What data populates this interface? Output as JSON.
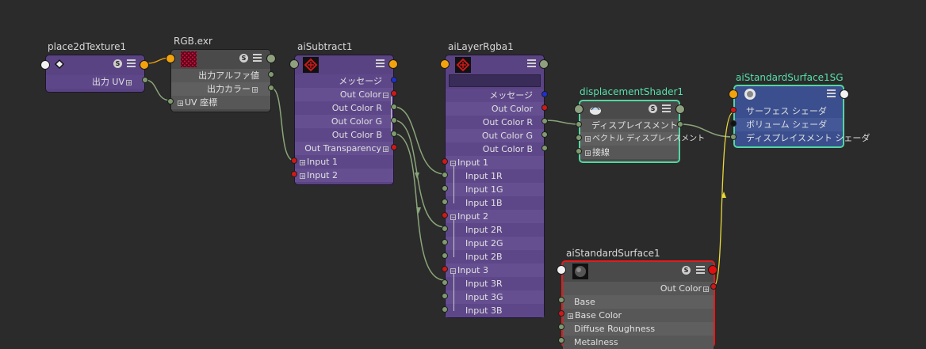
{
  "nodes": {
    "place2d": {
      "title": "place2dTexture1",
      "out_uv": "出力 UV",
      "badge": "S"
    },
    "rgb": {
      "title": "RGB.exr",
      "out_alpha": "出力アルファ値",
      "out_color": "出力カラー",
      "uv_coord": "UV 座標",
      "badge": "S"
    },
    "subtract": {
      "title": "aiSubtract1",
      "rows": [
        "メッセージ",
        "Out Color",
        "Out Color R",
        "Out Color G",
        "Out Color B",
        "Out Transparency",
        "Input 1",
        "Input 2"
      ]
    },
    "layer": {
      "title": "aiLayerRgba1",
      "rows": [
        "メッセージ",
        "Out Color",
        "Out Color R",
        "Out Color G",
        "Out Color B",
        "Input 1",
        "Input 1R",
        "Input 1G",
        "Input 1B",
        "Input 2",
        "Input 2R",
        "Input 2G",
        "Input 2B",
        "Input 3",
        "Input 3R",
        "Input 3G",
        "Input 3B"
      ]
    },
    "disp": {
      "title": "displacementShader1",
      "rows": [
        "ディスプレイスメント",
        "ベクトル ディスプレイスメント",
        "接線"
      ],
      "badge": "S"
    },
    "sg": {
      "title": "aiStandardSurface1SG",
      "rows": [
        "サーフェス シェーダ",
        "ボリューム シェーダ",
        "ディスプレイスメント シェーダ"
      ]
    },
    "surface": {
      "title": "aiStandardSurface1",
      "out_color": "Out Color",
      "rows": [
        "Base",
        "Base Color",
        "Diffuse Roughness",
        "Metalness"
      ],
      "badge": "S"
    }
  },
  "colors": {
    "background": "#2b2b2b",
    "node_purple": "#5a4383",
    "node_gray": "#4a4a4a",
    "node_blue": "#3b4f8f",
    "highlight_green": "#52d6a0",
    "highlight_red": "#e51b1b",
    "wire": "#8aa57a",
    "wire_yellow": "#e8d838"
  },
  "icons": [
    "texture-placement-icon",
    "checker-texture-icon",
    "arnold-logo-icon",
    "displacement-icon",
    "shading-group-icon",
    "sphere-icon",
    "s-badge-icon",
    "menu-icon"
  ]
}
